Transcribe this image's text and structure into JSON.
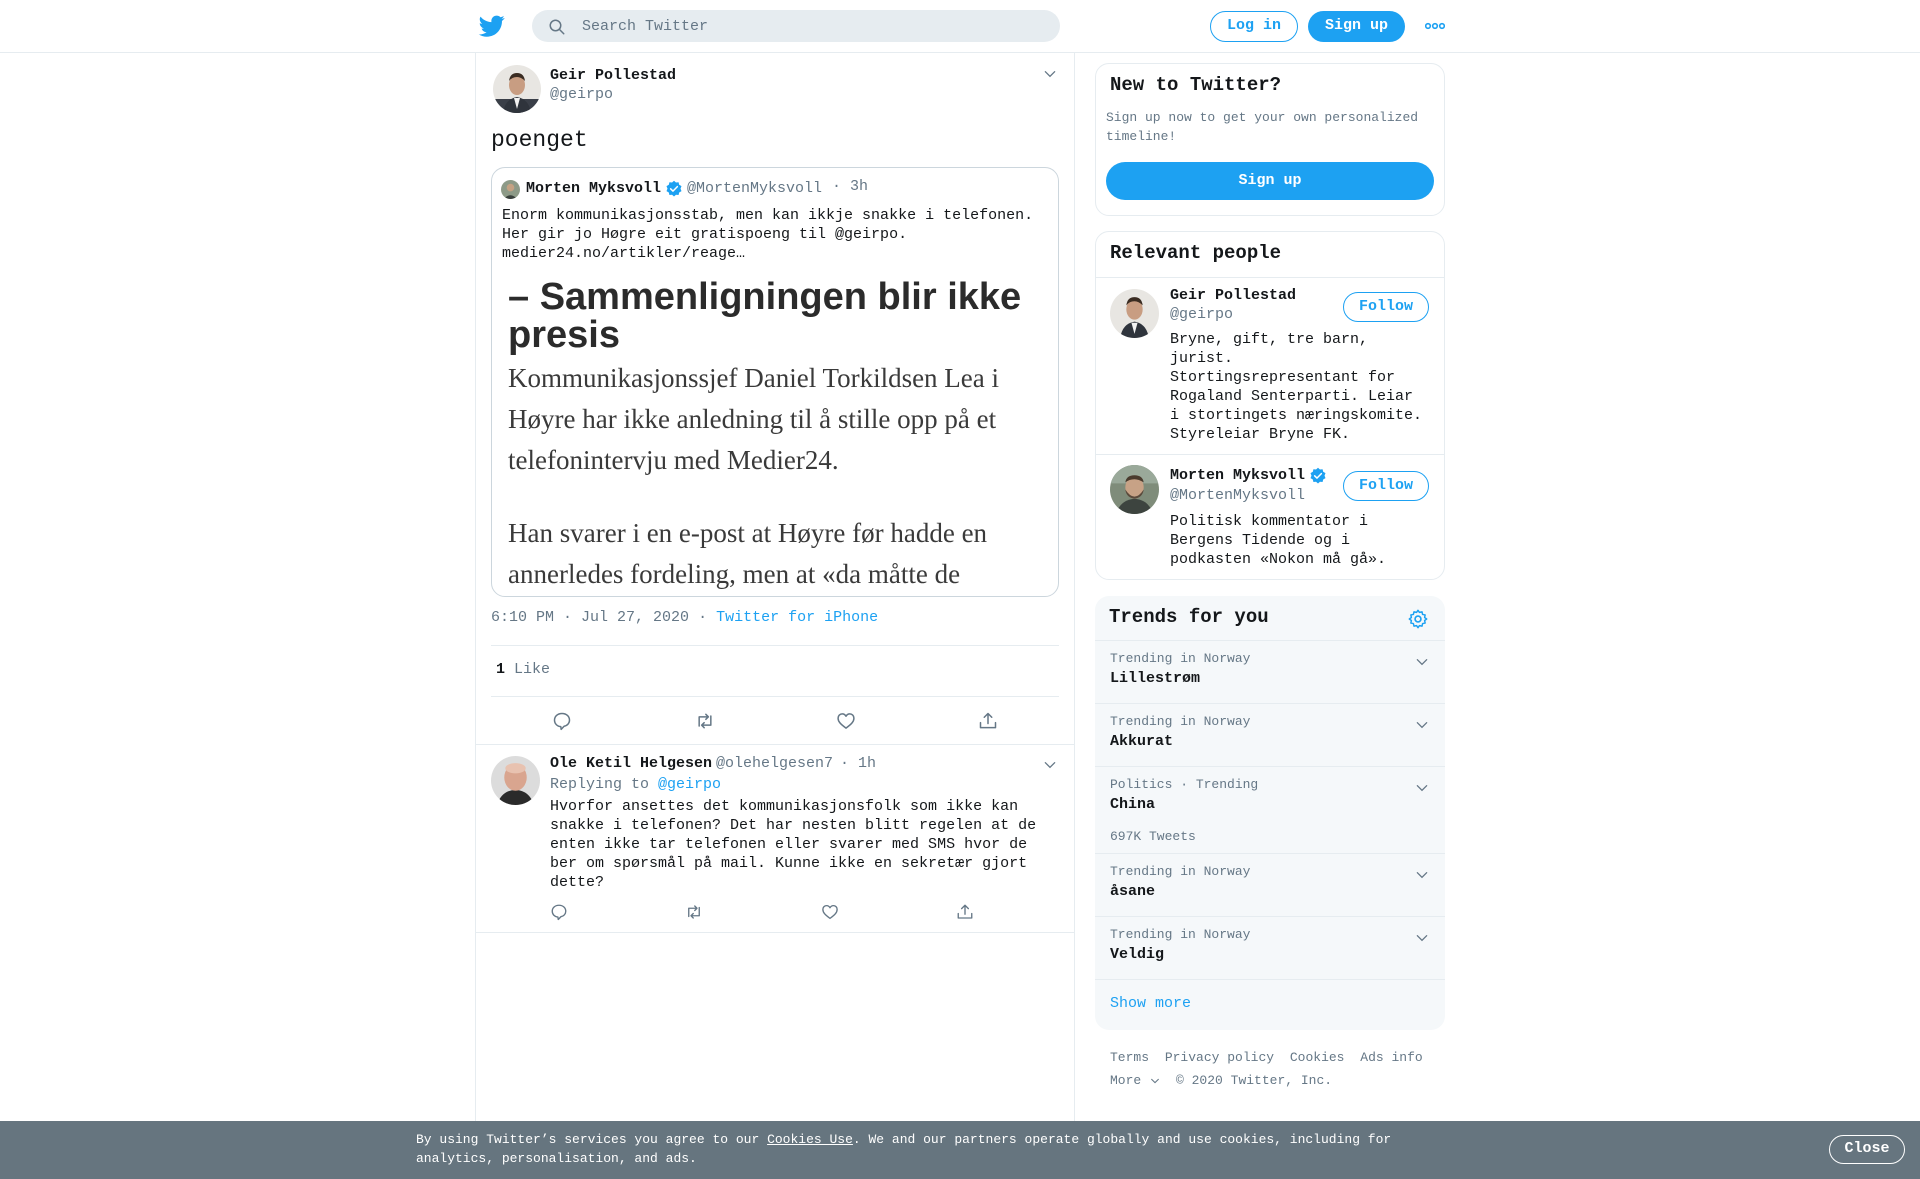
{
  "header": {
    "search_placeholder": "Search Twitter",
    "login_label": "Log in",
    "signup_label": "Sign up"
  },
  "tweet": {
    "author_name": "Geir Pollestad",
    "author_handle": "@geirpo",
    "text": "poenget",
    "quoted": {
      "author_name": "Morten Myksvoll",
      "author_handle": "@MortenMyksvoll",
      "time": "3h",
      "text": "Enorm kommunikasjonsstab, men kan ikkje snakke i telefonen. Her gir jo Høgre eit gratispoeng til @geirpo. medier24.no/artikler/reage…",
      "headline": "– Sammenligningen blir ikke presis",
      "article_p1": "Kommunikasjonssjef Daniel Torkildsen Lea i Høyre har ikke anledning til å stille opp på et telefonintervju med Medier24.",
      "article_p2": "Han svarer i en e-post at Høyre før hadde en annerledes fordeling, men at «da måtte de"
    },
    "timestamp": "6:10 PM · Jul 27, 2020",
    "sep": "·",
    "source": "Twitter for iPhone",
    "likes_count": "1",
    "likes_label": "Like"
  },
  "reply": {
    "author_name": "Ole Ketil Helgesen",
    "author_handle": "@olehelgesen7",
    "time": "· 1h",
    "replying_prefix": "Replying to",
    "replying_to": "@geirpo",
    "text": "Hvorfor ansettes det kommunikasjonsfolk som ikke kan snakke i telefonen? Det har nesten blitt regelen at de enten ikke tar telefonen eller svarer med SMS hvor de ber om spørsmål på mail. Kunne ikke en sekretær gjort dette?"
  },
  "new_to_twitter": {
    "title": "New to Twitter?",
    "subtitle": "Sign up now to get your own personalized timeline!",
    "signup_label": "Sign up"
  },
  "relevant_people": {
    "title": "Relevant people",
    "people": [
      {
        "name": "Geir Pollestad",
        "handle": "@geirpo",
        "follow_label": "Follow",
        "bio": "Bryne, gift, tre barn, jurist. Stortingsrepresentant for Rogaland Senterparti. Leiar i stortingets næringskomite. Styreleiar Bryne FK."
      },
      {
        "name": "Morten Myksvoll",
        "handle": "@MortenMyksvoll",
        "follow_label": "Follow",
        "bio": "Politisk kommentator i Bergens Tidende og i podkasten «Nokon må gå»."
      }
    ]
  },
  "trends": {
    "title": "Trends for you",
    "items": [
      {
        "context": "Trending in Norway",
        "name": "Lillestrøm"
      },
      {
        "context": "Trending in Norway",
        "name": "Akkurat"
      },
      {
        "context": "Politics · Trending",
        "name": "China",
        "count": "697K Tweets"
      },
      {
        "context": "Trending in Norway",
        "name": "åsane"
      },
      {
        "context": "Trending in Norway",
        "name": "Veldig"
      }
    ],
    "show_more": "Show more"
  },
  "footer": {
    "links": [
      "Terms",
      "Privacy policy",
      "Cookies",
      "Ads info"
    ],
    "more": "More",
    "copyright": "© 2020 Twitter, Inc."
  },
  "cookie_banner": {
    "text_before": "By using Twitter’s services you agree to our",
    "link": "Cookies Use",
    "text_after": ". We and our partners operate globally and use cookies, including for analytics, personalisation, and ads.",
    "close_label": "Close"
  },
  "colors": {
    "accent": "#1da1f2",
    "muted": "#657786",
    "border": "#e6ecf0",
    "banner": "#66757f"
  }
}
